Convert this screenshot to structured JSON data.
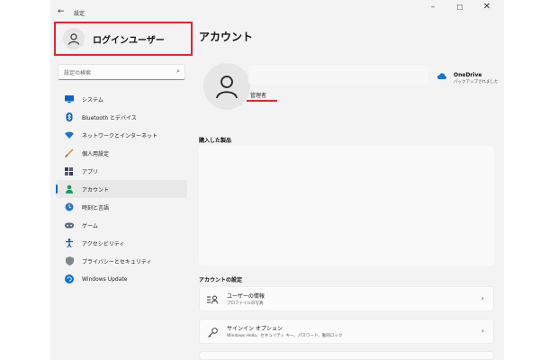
{
  "titlebar": {
    "back_glyph": "←",
    "title": "設定",
    "minimize_glyph": "–",
    "maximize_glyph": "☐",
    "close_glyph": "✕"
  },
  "user": {
    "name": "ログインユーザー",
    "role": "管理者"
  },
  "search": {
    "placeholder": "設定の検索",
    "icon": "search-icon"
  },
  "nav": {
    "items": [
      {
        "label": "システム",
        "icon": "system-icon",
        "active": false
      },
      {
        "label": "Bluetooth とデバイス",
        "icon": "bluetooth-icon",
        "active": false
      },
      {
        "label": "ネットワークとインターネット",
        "icon": "network-icon",
        "active": false
      },
      {
        "label": "個人用設定",
        "icon": "personalization-icon",
        "active": false
      },
      {
        "label": "アプリ",
        "icon": "apps-icon",
        "active": false
      },
      {
        "label": "アカウント",
        "icon": "accounts-icon",
        "active": true
      },
      {
        "label": "時刻と言語",
        "icon": "time-language-icon",
        "active": false
      },
      {
        "label": "ゲーム",
        "icon": "gaming-icon",
        "active": false
      },
      {
        "label": "アクセシビリティ",
        "icon": "accessibility-icon",
        "active": false
      },
      {
        "label": "プライバシーとセキュリティ",
        "icon": "privacy-icon",
        "active": false
      },
      {
        "label": "Windows Update",
        "icon": "windows-update-icon",
        "active": false
      }
    ]
  },
  "main": {
    "title": "アカウント",
    "onedrive_title": "OneDrive",
    "onedrive_sub": "バックアップされました",
    "products_title": "購入した製品",
    "settings_title": "アカウントの設定",
    "cards": [
      {
        "title": "ユーザーの情報",
        "sub": "プロファイルの写真",
        "icon": "user-info-icon",
        "chevron": "›"
      },
      {
        "title": "サインイン オプション",
        "sub": "Windows Hello、セキュリティ キー、パスワード、動的ロック",
        "icon": "key-icon",
        "chevron": "›"
      }
    ]
  },
  "colors": {
    "highlight": "#e0262f",
    "accent": "#0067c0",
    "onedrive": "#0a78d4"
  }
}
